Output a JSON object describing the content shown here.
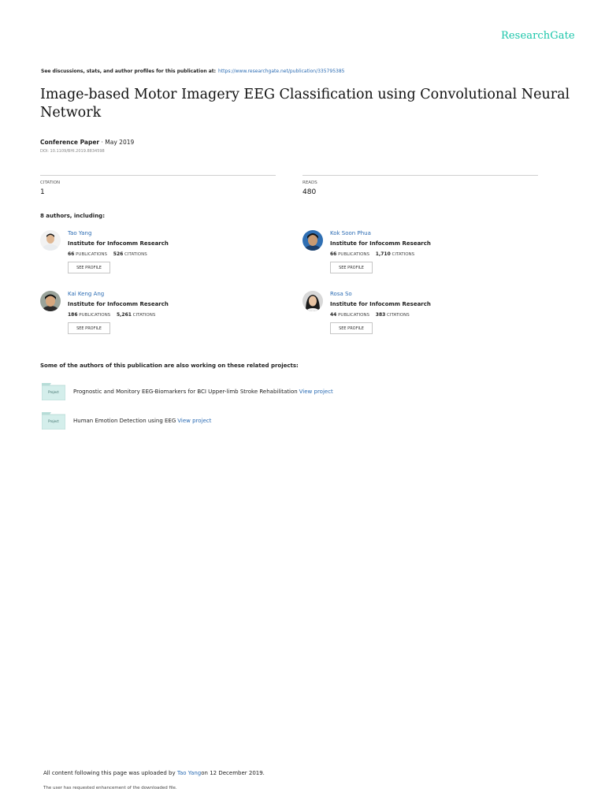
{
  "brand": {
    "name": "ResearchGate",
    "color": "#19c5a9"
  },
  "header": {
    "discuss_text": "See discussions, stats, and author profiles for this publication at:",
    "url": "https://www.researchgate.net/publication/335795385"
  },
  "paper": {
    "title": "Image-based Motor Imagery EEG Classification using Convolutional Neural Network",
    "type": "Conference Paper",
    "separator": " · ",
    "date": "May 2019",
    "doi": "DOI: 10.1109/BHI.2019.8834598"
  },
  "stats": {
    "citation_label": "CITATION",
    "citation_value": "1",
    "reads_label": "READS",
    "reads_value": "480"
  },
  "authors_heading": "8 authors, including:",
  "authors": [
    {
      "name": "Tao Yang",
      "institution": "Institute for Infocomm Research",
      "publications": "66",
      "publications_label": "PUBLICATIONS",
      "citations": "526",
      "citations_label": "CITATIONS",
      "button": "SEE PROFILE"
    },
    {
      "name": "Kok Soon Phua",
      "institution": "Institute for Infocomm Research",
      "publications": "66",
      "publications_label": "PUBLICATIONS",
      "citations": "1,710",
      "citations_label": "CITATIONS",
      "button": "SEE PROFILE"
    },
    {
      "name": "Kai Keng Ang",
      "institution": "Institute for Infocomm Research",
      "publications": "186",
      "publications_label": "PUBLICATIONS",
      "citations": "5,261",
      "citations_label": "CITATIONS",
      "button": "SEE PROFILE"
    },
    {
      "name": "Rosa So",
      "institution": "Institute for Infocomm Research",
      "publications": "44",
      "publications_label": "PUBLICATIONS",
      "citations": "383",
      "citations_label": "CITATIONS",
      "button": "SEE PROFILE"
    }
  ],
  "related_heading": "Some of the authors of this publication are also working on these related projects:",
  "projects": [
    {
      "icon_label": "Project",
      "title": "Prognostic and Monitory EEG-Biomarkers for BCI Upper-limb Stroke Rehabilitation",
      "link": "View project"
    },
    {
      "icon_label": "Project",
      "title": "Human Emotion Detection using EEG",
      "link": "View project"
    }
  ],
  "footer": {
    "upload_prefix": "All content following this page was uploaded by",
    "uploader": "Tao Yang",
    "upload_suffix": "on 12 December 2019.",
    "note": "The user has requested enhancement of the downloaded file."
  }
}
